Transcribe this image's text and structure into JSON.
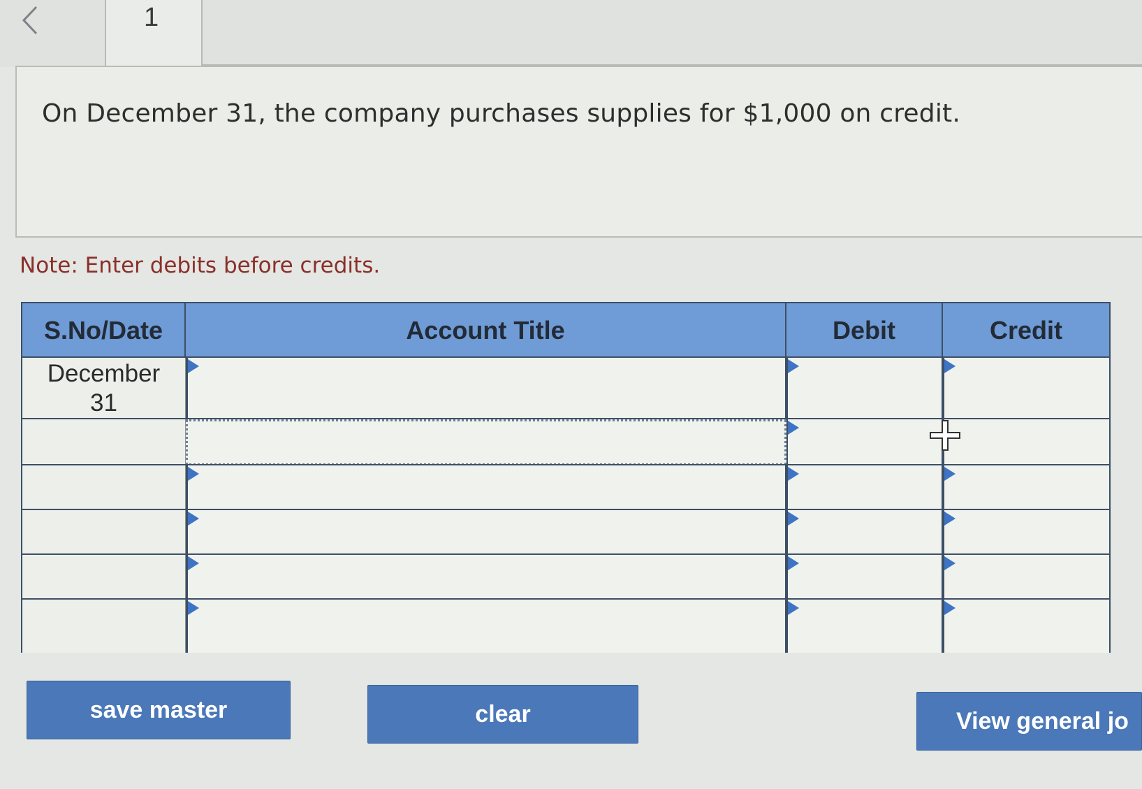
{
  "tabs": {
    "current_number": "1"
  },
  "question": {
    "text": "On December 31, the company purchases supplies for $1,000 on credit."
  },
  "note": "Note: Enter debits before credits.",
  "journal": {
    "headers": {
      "date": "S.No/Date",
      "account": "Account Title",
      "debit": "Debit",
      "credit": "Credit"
    },
    "rows": [
      {
        "date_line1": "December",
        "date_line2": "31",
        "account": "",
        "debit": "",
        "credit": ""
      },
      {
        "date_line1": "",
        "date_line2": "",
        "account": "",
        "debit": "",
        "credit": ""
      },
      {
        "date_line1": "",
        "date_line2": "",
        "account": "",
        "debit": "",
        "credit": ""
      },
      {
        "date_line1": "",
        "date_line2": "",
        "account": "",
        "debit": "",
        "credit": ""
      },
      {
        "date_line1": "",
        "date_line2": "",
        "account": "",
        "debit": "",
        "credit": ""
      },
      {
        "date_line1": "",
        "date_line2": "",
        "account": "",
        "debit": "",
        "credit": ""
      }
    ]
  },
  "buttons": {
    "save": "save master",
    "clear": "clear",
    "view": "View general jo"
  },
  "colors": {
    "header_blue": "#6f9bd6",
    "button_blue": "#4a78b9",
    "note_red": "#8b2f2a"
  },
  "icons": {
    "back": "chevron-left-icon",
    "dropdown": "dropdown-triangle-icon",
    "cursor": "move-cursor-icon"
  }
}
